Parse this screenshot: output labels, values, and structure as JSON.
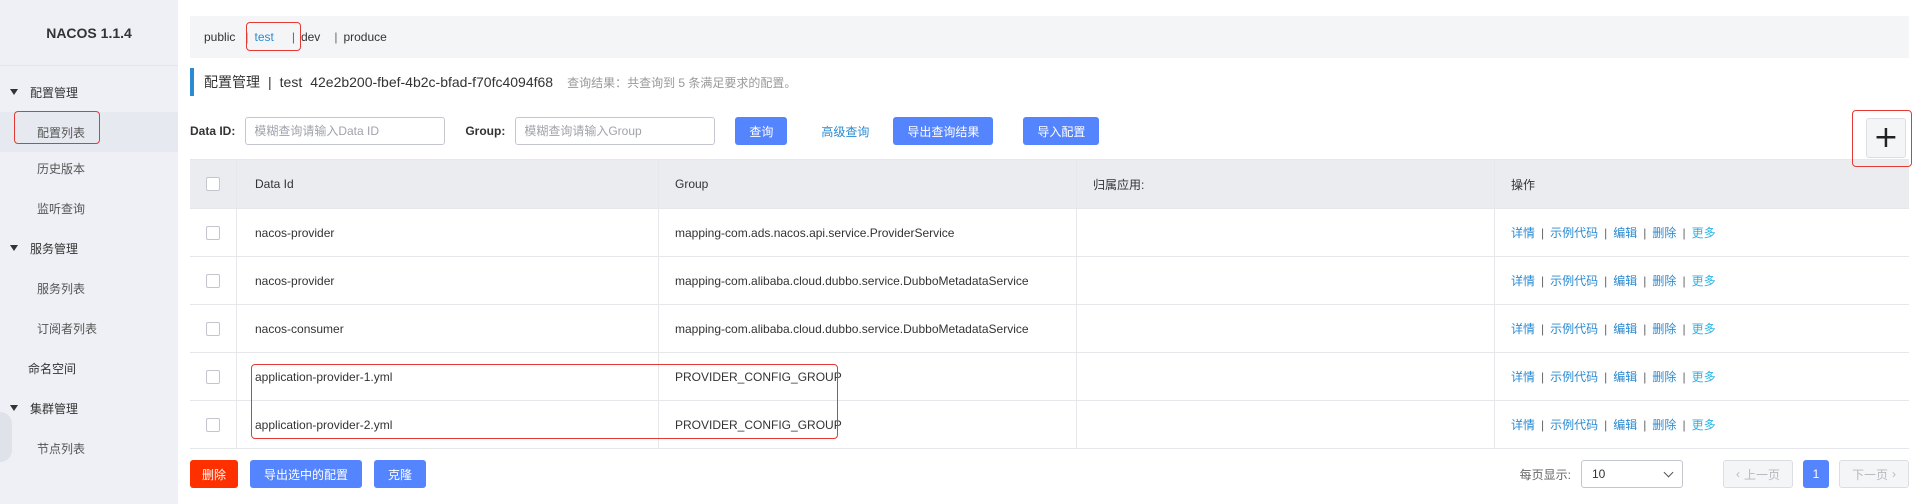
{
  "brand": "NACOS 1.1.4",
  "sidebar": {
    "config_group": "配置管理",
    "config_items": [
      "配置列表",
      "历史版本",
      "监听查询"
    ],
    "service_group": "服务管理",
    "service_items": [
      "服务列表",
      "订阅者列表"
    ],
    "namespace": "命名空间",
    "cluster_group": "集群管理",
    "cluster_items": [
      "节点列表"
    ]
  },
  "namespaces": {
    "items": [
      "public",
      "test",
      "dev",
      "produce"
    ],
    "active": "test",
    "separator": "|"
  },
  "page_title": {
    "main": "配置管理",
    "separator": "|",
    "namespace": "test",
    "namespace_id": "42e2b200-fbef-4b2c-bfad-f70fc4094f68",
    "hint": "查询结果：共查询到 5 条满足要求的配置。"
  },
  "filters": {
    "data_id_label": "Data ID:",
    "data_id_placeholder": "模糊查询请输入Data ID",
    "group_label": "Group:",
    "group_placeholder": "模糊查询请输入Group",
    "query_button": "查询",
    "advanced_query": "高级查询",
    "export_results_button": "导出查询结果",
    "import_button": "导入配置",
    "add_button": "+"
  },
  "table": {
    "headers": [
      "Data Id",
      "Group",
      "归属应用:",
      "操作"
    ],
    "rows": [
      {
        "data_id": "nacos-provider",
        "group": "mapping-com.ads.nacos.api.service.ProviderService",
        "app": ""
      },
      {
        "data_id": "nacos-provider",
        "group": "mapping-com.alibaba.cloud.dubbo.service.DubboMetadataService",
        "app": ""
      },
      {
        "data_id": "nacos-consumer",
        "group": "mapping-com.alibaba.cloud.dubbo.service.DubboMetadataService",
        "app": ""
      },
      {
        "data_id": "application-provider-1.yml",
        "group": "PROVIDER_CONFIG_GROUP",
        "app": ""
      },
      {
        "data_id": "application-provider-2.yml",
        "group": "PROVIDER_CONFIG_GROUP",
        "app": ""
      }
    ],
    "ops": [
      "详情",
      "示例代码",
      "编辑",
      "删除",
      "更多"
    ]
  },
  "footer": {
    "delete_button": "删除",
    "export_selected_button": "导出选中的配置",
    "clone_button": "克隆",
    "page_size_label": "每页显示:",
    "page_size_value": "10",
    "prev_button": "上一页",
    "next_button": "下一页",
    "current_page": "1"
  },
  "colors": {
    "accent": "#5584ff",
    "link": "#2a8bd3",
    "danger": "#ff3000",
    "annotation": "#e53935"
  }
}
